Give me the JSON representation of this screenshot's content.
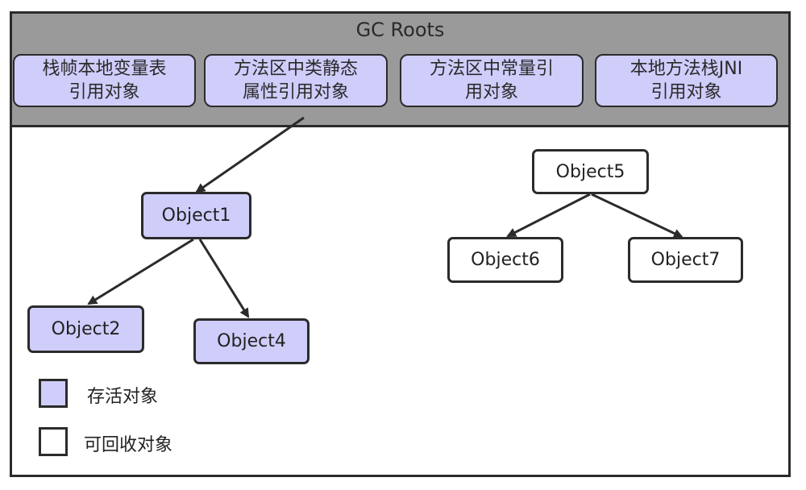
{
  "gc_roots": {
    "title": "GC Roots",
    "boxes": [
      {
        "line1": "栈帧本地变量表",
        "line2": "引用对象"
      },
      {
        "line1": "方法区中类静态",
        "line2": "属性引用对象"
      },
      {
        "line1": "方法区中常量引",
        "line2": "用对象"
      },
      {
        "line1": "本地方法栈JNI",
        "line2": "引用对象"
      }
    ]
  },
  "objects": {
    "object1": "Object1",
    "object2": "Object2",
    "object4": "Object4",
    "object5": "Object5",
    "object6": "Object6",
    "object7": "Object7"
  },
  "edges": [
    [
      "gc-roots",
      "object1"
    ],
    [
      "object1",
      "object2"
    ],
    [
      "object1",
      "object4"
    ],
    [
      "object5",
      "object6"
    ],
    [
      "object5",
      "object7"
    ]
  ],
  "legend": {
    "live_label": "存活对象",
    "collectable_label": "可回收对象"
  },
  "colors": {
    "live_fill": "#cfcdfa",
    "collectable_fill": "#ffffff",
    "roots_band": "#9a9a9a",
    "stroke": "#2b2b2b"
  }
}
